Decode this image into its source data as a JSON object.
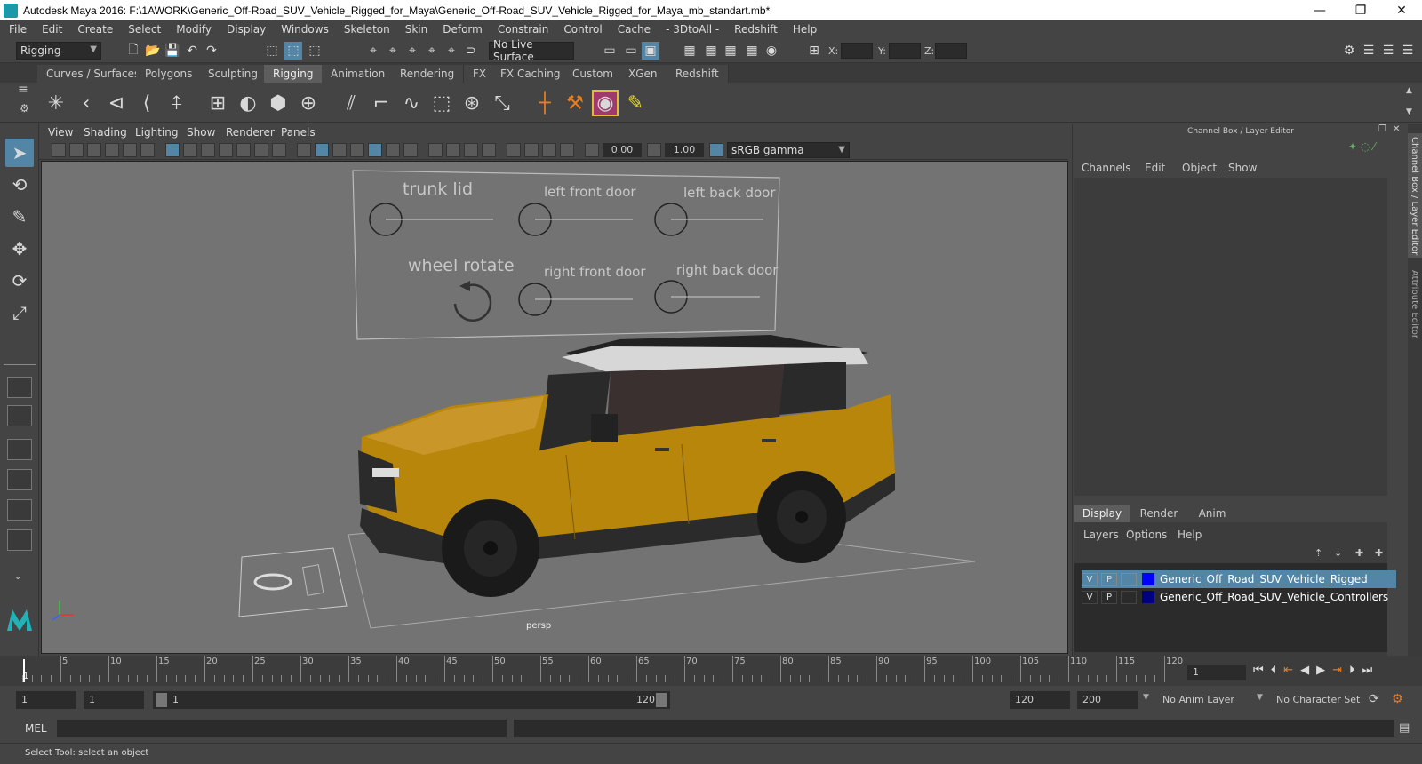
{
  "window": {
    "title": "Autodesk Maya 2016: F:\\1AWORK\\Generic_Off-Road_SUV_Vehicle_Rigged_for_Maya\\Generic_Off-Road_SUV_Vehicle_Rigged_for_Maya_mb_standart.mb*",
    "minimize": "—",
    "restore": "❐",
    "close": "✕"
  },
  "menubar": [
    "File",
    "Edit",
    "Create",
    "Select",
    "Modify",
    "Display",
    "Windows",
    "Skeleton",
    "Skin",
    "Deform",
    "Constrain",
    "Control",
    "Cache",
    "- 3DtoAll -",
    "Redshift",
    "Help"
  ],
  "statusline": {
    "mode": "Rigging",
    "live_surface": "No Live Surface",
    "x_label": "X:",
    "y_label": "Y:",
    "z_label": "Z:"
  },
  "shelf_tabs": [
    "Curves / Surfaces",
    "Polygons",
    "Sculpting",
    "Rigging",
    "Animation",
    "Rendering",
    "FX",
    "FX Caching",
    "Custom",
    "XGen",
    "Redshift"
  ],
  "active_shelf_tab": "Rigging",
  "panel_menu": [
    "View",
    "Shading",
    "Lighting",
    "Show",
    "Renderer",
    "Panels"
  ],
  "panel_toolbar": {
    "exposure": "0.00",
    "gamma": "1.00",
    "color_space": "sRGB gamma"
  },
  "viewport": {
    "camera_label": "persp",
    "controls": {
      "trunk_lid": "trunk lid",
      "left_front_door": "left front door",
      "left_back_door": "left back door",
      "wheel_rotate": "wheel rotate",
      "right_front_door": "right front door",
      "right_back_door": "right back door"
    },
    "colors": {
      "body": "#b8860b",
      "background": "#737373"
    }
  },
  "channel_box": {
    "title": "Channel Box / Layer Editor",
    "menus": [
      "Channels",
      "Edit",
      "Object",
      "Show"
    ]
  },
  "layer_editor": {
    "tabs": [
      "Display",
      "Render",
      "Anim"
    ],
    "active_tab": "Display",
    "menus": [
      "Layers",
      "Options",
      "Help"
    ],
    "layers": [
      {
        "v": "V",
        "p": "P",
        "name": "Generic_Off_Road_SUV_Vehicle_Rigged",
        "color": "#0000ff",
        "selected": true
      },
      {
        "v": "V",
        "p": "P",
        "name": "Generic_Off_Road_SUV_Vehicle_Controllers",
        "color": "#000080",
        "selected": false
      }
    ]
  },
  "side_tabs": [
    "Channel Box / Layer Editor",
    "Attribute Editor"
  ],
  "time_slider": {
    "ticks": [
      "5",
      "10",
      "15",
      "20",
      "25",
      "30",
      "35",
      "40",
      "45",
      "50",
      "55",
      "60",
      "65",
      "70",
      "75",
      "80",
      "85",
      "90",
      "95",
      "100",
      "105",
      "110",
      "115",
      "120"
    ],
    "start_label": "1",
    "current_frame": "1"
  },
  "range_slider": {
    "start": "1",
    "playback_start": "1",
    "range_inner_start": "1",
    "range_inner_end": "120",
    "playback_end": "120",
    "end": "200",
    "anim_layer": "No Anim Layer",
    "character_set": "No Character Set"
  },
  "command_line": {
    "label": "MEL"
  },
  "help_line": "Select Tool: select an object"
}
